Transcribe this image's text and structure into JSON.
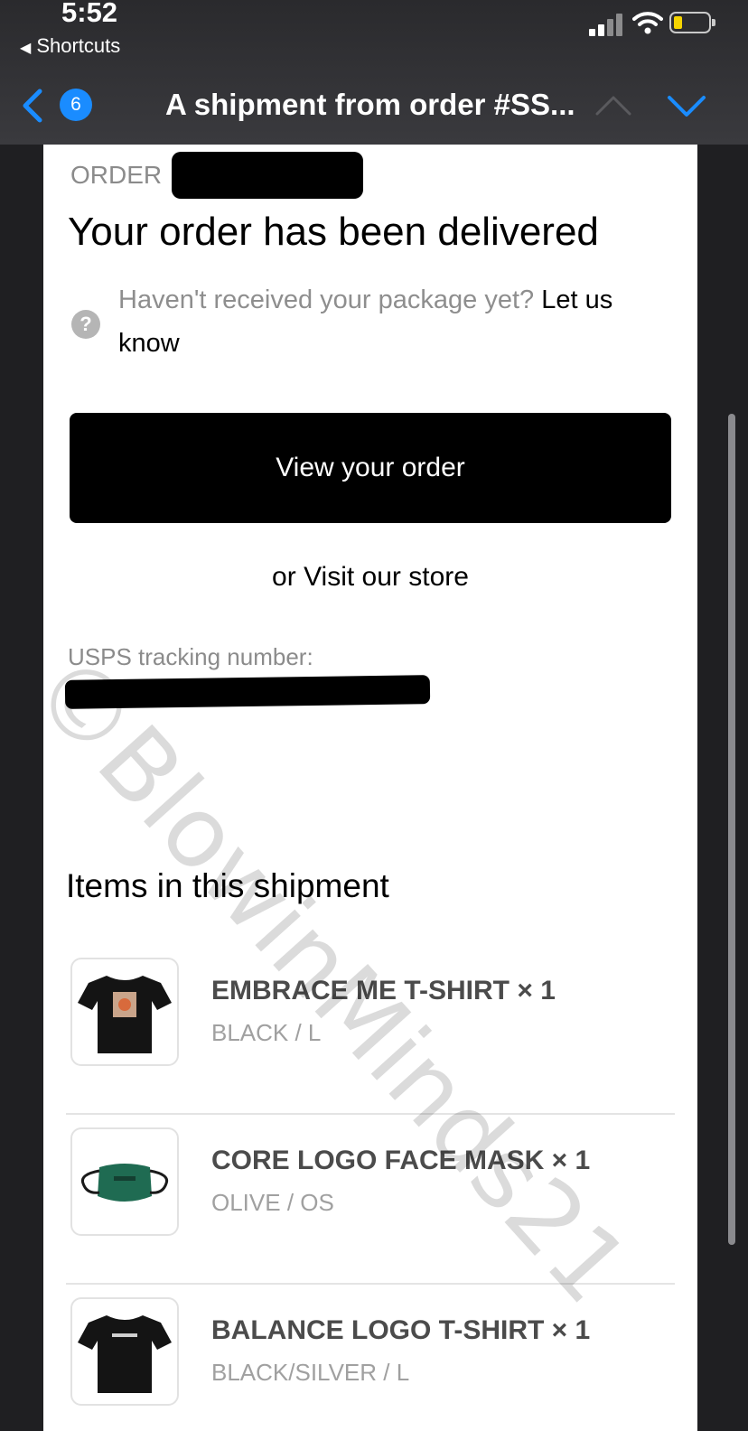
{
  "status_bar": {
    "time": "5:52",
    "back_app": "Shortcuts"
  },
  "nav": {
    "unread_count": "6",
    "title": "A shipment from order #SS..."
  },
  "email": {
    "order_label": "ORDER",
    "heading": "Your order has been delivered",
    "notice_text": "Haven't received your package yet?",
    "notice_link": "Let us know",
    "view_button": "View your order",
    "store_prefix": "or",
    "store_link": "Visit our store",
    "tracking_label": "USPS tracking number:",
    "items_heading": "Items in this shipment",
    "items": [
      {
        "name": "EMBRACE ME T-SHIRT × 1",
        "variant": "BLACK / L"
      },
      {
        "name": "CORE LOGO FACE MASK × 1",
        "variant": "OLIVE / OS"
      },
      {
        "name": "BALANCE LOGO T-SHIRT × 1",
        "variant": "BLACK/SILVER / L"
      }
    ]
  },
  "watermark": "©BlowinMinds21",
  "colors": {
    "accent": "#1a8cff",
    "button_bg": "#000000",
    "mask": "#1f6b52"
  }
}
